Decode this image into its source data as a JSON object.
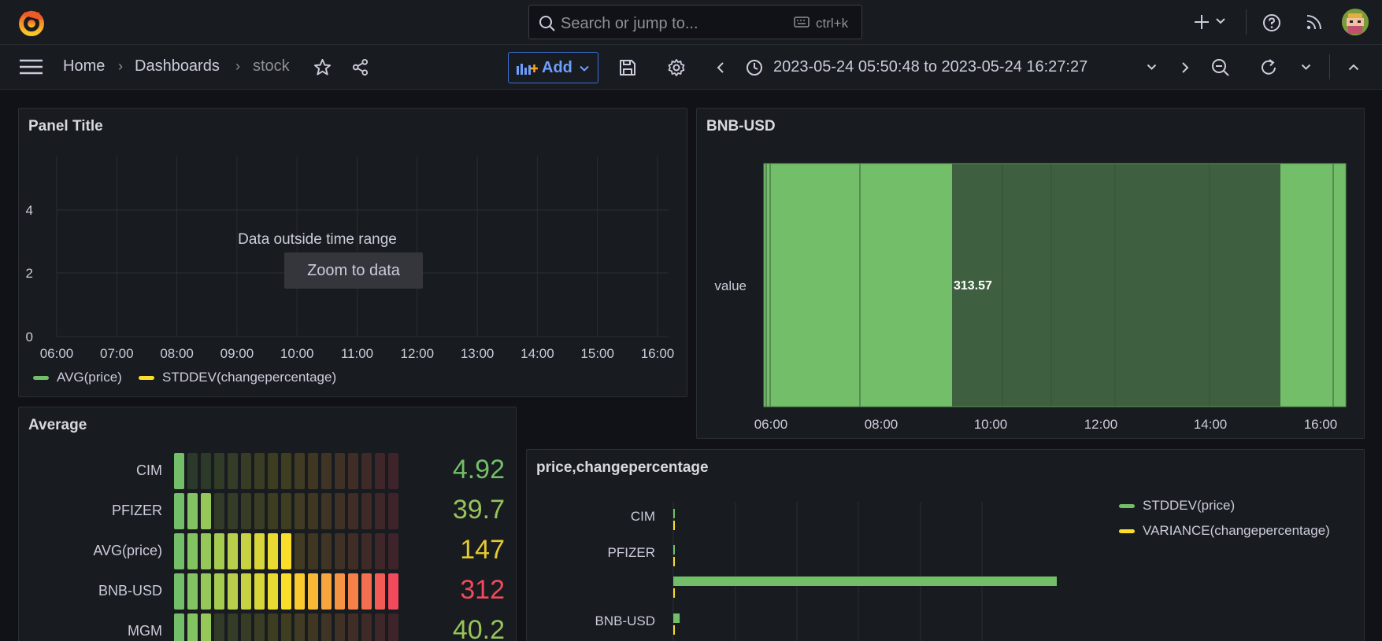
{
  "colors": {
    "bg": "#111217",
    "panel": "#181b1f",
    "green": "#73bf69",
    "dark_green": "#3f6040",
    "yellow": "#fade2a",
    "red": "#f2495c",
    "blue": "#6e9fff"
  },
  "topbar": {
    "logo_icon": "grafana-logo-icon",
    "search_placeholder": "Search or jump to...",
    "search_shortcut": "ctrl+k",
    "icons": [
      "plus-icon",
      "chevron-down-icon",
      "help-icon",
      "rss-icon",
      "avatar"
    ]
  },
  "navbar": {
    "breadcrumbs": [
      "Home",
      "Dashboards",
      "stock"
    ],
    "add_label": "Add",
    "time_range": "2023-05-24 05:50:48 to 2023-05-24 16:27:27",
    "icons": [
      "menu-icon",
      "star-icon",
      "share-icon",
      "save-icon",
      "gear-icon",
      "chevron-left-icon",
      "clock-icon",
      "chevron-down-icon",
      "chevron-right-icon",
      "zoom-out-icon",
      "refresh-icon",
      "chevron-down-icon",
      "chevron-up-icon"
    ]
  },
  "panels": {
    "timeseries": {
      "title": "Panel Title",
      "y_ticks": [
        "4",
        "2",
        "0"
      ],
      "x_ticks": [
        "06:00",
        "07:00",
        "08:00",
        "09:00",
        "10:00",
        "11:00",
        "12:00",
        "13:00",
        "14:00",
        "15:00",
        "16:00"
      ],
      "message": "Data outside time range",
      "zoom_label": "Zoom to data",
      "legend": [
        {
          "name": "AVG(price)",
          "color": "#73bf69"
        },
        {
          "name": "STDDEV(changepercentage)",
          "color": "#fade2a"
        }
      ]
    },
    "state": {
      "title": "BNB-USD",
      "row_label": "value",
      "value_label": "313.57",
      "x_ticks": [
        "06:00",
        "08:00",
        "10:00",
        "12:00",
        "14:00",
        "16:00"
      ]
    },
    "average": {
      "title": "Average",
      "rows": [
        {
          "label": "CIM",
          "value": "4.92",
          "lit": 1,
          "color": "#73bf69"
        },
        {
          "label": "PFIZER",
          "value": "39.7",
          "lit": 3,
          "color": "#96c45a"
        },
        {
          "label": "AVG(price)",
          "value": "147",
          "lit": 9,
          "color": "#e5c932"
        },
        {
          "label": "BNB-USD",
          "value": "312",
          "lit": 17,
          "color": "#f2495c"
        },
        {
          "label": "MGM",
          "value": "40.2",
          "lit": 3,
          "color": "#96c45a"
        }
      ]
    },
    "barchart": {
      "title": "price,changepercentage",
      "categories": [
        "CIM",
        "PFIZER",
        "",
        "BNB-USD"
      ],
      "legend": [
        {
          "name": "STDDEV(price)",
          "color": "#73bf69"
        },
        {
          "name": "VARIANCE(changepercentage)",
          "color": "#fade2a"
        }
      ]
    }
  },
  "chart_data": [
    {
      "type": "line",
      "title": "Panel Title",
      "x": [
        "06:00",
        "07:00",
        "08:00",
        "09:00",
        "10:00",
        "11:00",
        "12:00",
        "13:00",
        "14:00",
        "15:00",
        "16:00"
      ],
      "ylim": [
        0,
        5
      ],
      "series": [
        {
          "name": "AVG(price)",
          "values": []
        },
        {
          "name": "STDDEV(changepercentage)",
          "values": []
        }
      ],
      "annotation": "Data outside time range",
      "legend": "bottom-left",
      "grid": true
    },
    {
      "type": "bar",
      "title": "BNB-USD",
      "categories": [
        "value"
      ],
      "x_ticks": [
        "06:00",
        "08:00",
        "10:00",
        "12:00",
        "14:00",
        "16:00"
      ],
      "annotation": "313.57"
    },
    {
      "type": "bar",
      "title": "Average",
      "categories": [
        "CIM",
        "PFIZER",
        "AVG(price)",
        "BNB-USD",
        "MGM"
      ],
      "values": [
        4.92,
        39.7,
        147,
        312,
        40.2
      ]
    },
    {
      "type": "bar",
      "title": "price,changepercentage",
      "categories": [
        "CIM",
        "PFIZER",
        "",
        "BNB-USD"
      ],
      "series": [
        {
          "name": "STDDEV(price)",
          "values": [
            1,
            1,
            480,
            8
          ]
        },
        {
          "name": "VARIANCE(changepercentage)",
          "values": [
            1,
            1,
            1,
            1
          ]
        }
      ],
      "legend": "top-right",
      "grid": true
    }
  ]
}
